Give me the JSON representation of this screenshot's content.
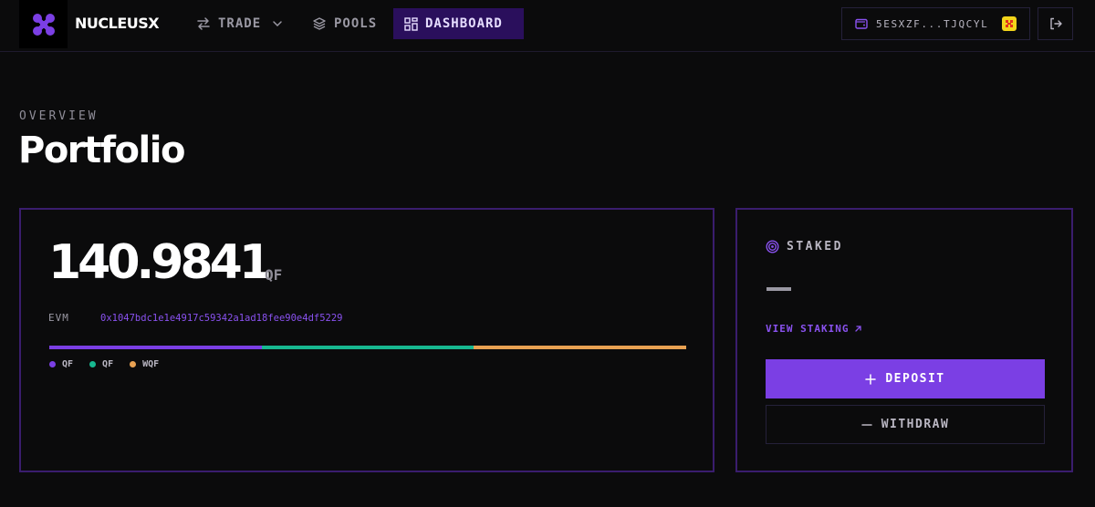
{
  "app": {
    "brand": "NUCLEUSX"
  },
  "nav": {
    "trade_label": "TRADE",
    "pools_label": "POOLS",
    "dashboard_label": "DASHBOARD",
    "active": "DASHBOARD"
  },
  "wallet": {
    "address": "5ESXZF...TJQCYL"
  },
  "page": {
    "eyebrow": "OVERVIEW",
    "title": "Portfolio"
  },
  "portfolio": {
    "balance": "140.9841",
    "unit": "QF",
    "evm_label": "EVM",
    "evm_address": "0x1047bdc1e1e4917c59342a1ad18fee90e4df5229",
    "allocation": [
      {
        "label": "QF",
        "color": "#7b3fe4",
        "share": 0.3333
      },
      {
        "label": "QF",
        "color": "#17b890",
        "share": 0.3333
      },
      {
        "label": "WQF",
        "color": "#e8a152",
        "share": 0.3334
      }
    ]
  },
  "staked": {
    "title": "STAKED",
    "value": "—",
    "view_link": "VIEW STAKING",
    "deposit_label": "DEPOSIT",
    "withdraw_label": "WITHDRAW"
  },
  "colors": {
    "accent": "#7b3fe4",
    "nav_active_bg": "#2a0f5c",
    "card_border": "#3a1d6e",
    "background": "#0b0b0c"
  }
}
